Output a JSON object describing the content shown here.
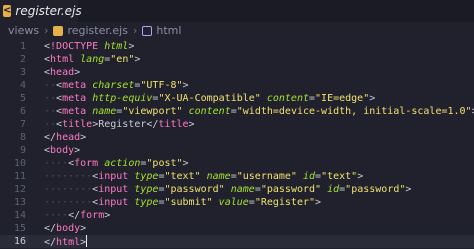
{
  "tab": {
    "filename": "register.ejs",
    "icon": "ejs-file-icon"
  },
  "breadcrumbs": [
    "views",
    "register.ejs",
    "html"
  ],
  "colors": {
    "tag": "#ff79c6",
    "attr": "#a6e22e",
    "string": "#f1e26f",
    "text": "#c9ccd8",
    "background": "#20212c"
  },
  "editor": {
    "active_line": 16,
    "lines": [
      {
        "n": "1",
        "indent": 0,
        "parts": [
          [
            "p",
            "<"
          ],
          [
            "t",
            "!DOCTYPE"
          ],
          [
            "p",
            " "
          ],
          [
            "a",
            "html"
          ],
          [
            "p",
            ">"
          ]
        ]
      },
      {
        "n": "2",
        "indent": 0,
        "parts": [
          [
            "p",
            "<"
          ],
          [
            "t",
            "html"
          ],
          [
            "p",
            " "
          ],
          [
            "a",
            "lang"
          ],
          [
            "p",
            "="
          ],
          [
            "s",
            "\"en\""
          ],
          [
            "p",
            ">"
          ]
        ]
      },
      {
        "n": "3",
        "indent": 0,
        "parts": [
          [
            "p",
            "<"
          ],
          [
            "t",
            "head"
          ],
          [
            "p",
            ">"
          ]
        ]
      },
      {
        "n": "4",
        "indent": 2,
        "parts": [
          [
            "p",
            "<"
          ],
          [
            "t",
            "meta"
          ],
          [
            "p",
            " "
          ],
          [
            "a",
            "charset"
          ],
          [
            "p",
            "="
          ],
          [
            "s",
            "\"UTF-8\""
          ],
          [
            "p",
            ">"
          ]
        ]
      },
      {
        "n": "5",
        "indent": 2,
        "parts": [
          [
            "p",
            "<"
          ],
          [
            "t",
            "meta"
          ],
          [
            "p",
            " "
          ],
          [
            "a",
            "http-equiv"
          ],
          [
            "p",
            "="
          ],
          [
            "s",
            "\"X-UA-Compatible\""
          ],
          [
            "p",
            " "
          ],
          [
            "a",
            "content"
          ],
          [
            "p",
            "="
          ],
          [
            "s",
            "\"IE=edge\""
          ],
          [
            "p",
            ">"
          ]
        ]
      },
      {
        "n": "6",
        "indent": 2,
        "parts": [
          [
            "p",
            "<"
          ],
          [
            "t",
            "meta"
          ],
          [
            "p",
            " "
          ],
          [
            "a",
            "name"
          ],
          [
            "p",
            "="
          ],
          [
            "s",
            "\"viewport\""
          ],
          [
            "p",
            " "
          ],
          [
            "a",
            "content"
          ],
          [
            "p",
            "="
          ],
          [
            "s",
            "\"width=device-width, initial-scale=1.0\""
          ],
          [
            "p",
            ">"
          ]
        ]
      },
      {
        "n": "7",
        "indent": 2,
        "parts": [
          [
            "p",
            "<"
          ],
          [
            "t",
            "title"
          ],
          [
            "p",
            ">Register</"
          ],
          [
            "t",
            "title"
          ],
          [
            "p",
            ">"
          ]
        ]
      },
      {
        "n": "8",
        "indent": 0,
        "parts": [
          [
            "p",
            "</"
          ],
          [
            "t",
            "head"
          ],
          [
            "p",
            ">"
          ]
        ]
      },
      {
        "n": "9",
        "indent": 0,
        "parts": [
          [
            "p",
            "<"
          ],
          [
            "t",
            "body"
          ],
          [
            "p",
            ">"
          ]
        ]
      },
      {
        "n": "10",
        "indent": 4,
        "parts": [
          [
            "p",
            "<"
          ],
          [
            "t",
            "form"
          ],
          [
            "p",
            " "
          ],
          [
            "a",
            "action"
          ],
          [
            "p",
            "="
          ],
          [
            "s",
            "\"post\""
          ],
          [
            "p",
            ">"
          ]
        ]
      },
      {
        "n": "11",
        "indent": 8,
        "parts": [
          [
            "p",
            "<"
          ],
          [
            "t",
            "input"
          ],
          [
            "p",
            " "
          ],
          [
            "a",
            "type"
          ],
          [
            "p",
            "="
          ],
          [
            "s",
            "\"text\""
          ],
          [
            "p",
            " "
          ],
          [
            "a",
            "name"
          ],
          [
            "p",
            "="
          ],
          [
            "s",
            "\"username\""
          ],
          [
            "p",
            " "
          ],
          [
            "a",
            "id"
          ],
          [
            "p",
            "="
          ],
          [
            "s",
            "\"text\""
          ],
          [
            "p",
            ">"
          ]
        ]
      },
      {
        "n": "12",
        "indent": 8,
        "parts": [
          [
            "p",
            "<"
          ],
          [
            "t",
            "input"
          ],
          [
            "p",
            " "
          ],
          [
            "a",
            "type"
          ],
          [
            "p",
            "="
          ],
          [
            "s",
            "\"password\""
          ],
          [
            "p",
            " "
          ],
          [
            "a",
            "name"
          ],
          [
            "p",
            "="
          ],
          [
            "s",
            "\"password\""
          ],
          [
            "p",
            " "
          ],
          [
            "a",
            "id"
          ],
          [
            "p",
            "="
          ],
          [
            "s",
            "\"password\""
          ],
          [
            "p",
            ">"
          ]
        ]
      },
      {
        "n": "13",
        "indent": 8,
        "parts": [
          [
            "p",
            "<"
          ],
          [
            "t",
            "input"
          ],
          [
            "p",
            " "
          ],
          [
            "a",
            "type"
          ],
          [
            "p",
            "="
          ],
          [
            "s",
            "\"submit\""
          ],
          [
            "p",
            " "
          ],
          [
            "a",
            "value"
          ],
          [
            "p",
            "="
          ],
          [
            "s",
            "\"Register\""
          ],
          [
            "p",
            ">"
          ]
        ]
      },
      {
        "n": "14",
        "indent": 4,
        "parts": [
          [
            "p",
            "</"
          ],
          [
            "t",
            "form"
          ],
          [
            "p",
            ">"
          ]
        ]
      },
      {
        "n": "15",
        "indent": 0,
        "parts": [
          [
            "p",
            "</"
          ],
          [
            "t",
            "body"
          ],
          [
            "p",
            ">"
          ]
        ]
      },
      {
        "n": "16",
        "indent": 0,
        "parts": [
          [
            "p",
            "</"
          ],
          [
            "t",
            "html"
          ],
          [
            "p",
            ">"
          ]
        ]
      }
    ]
  }
}
